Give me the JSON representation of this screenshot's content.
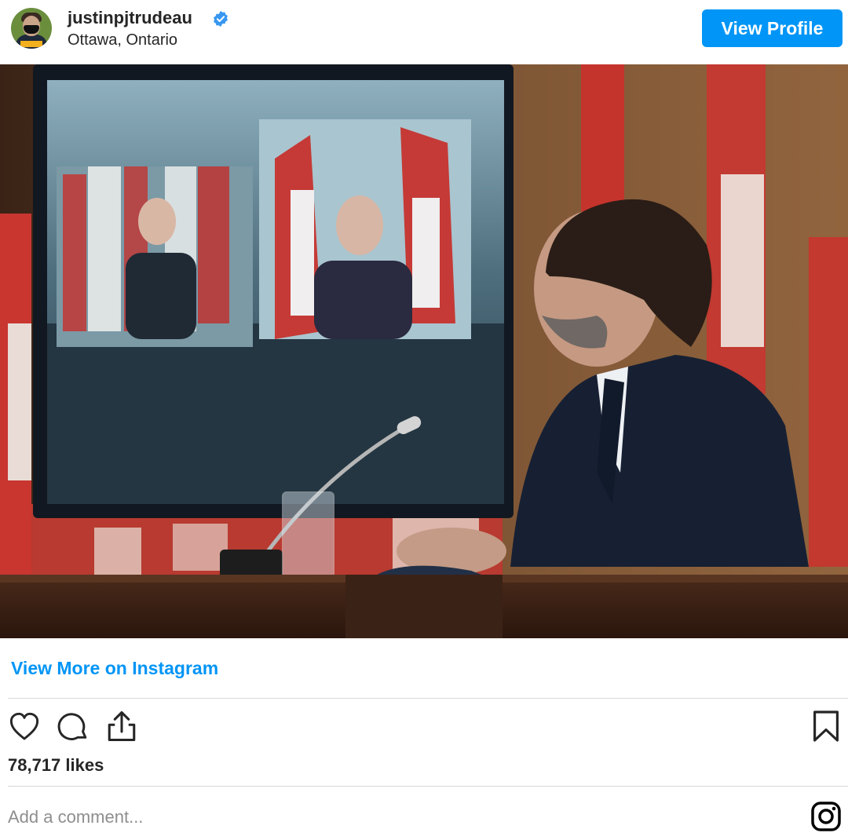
{
  "header": {
    "username": "justinpjtrudeau",
    "location": "Ottawa, Ontario",
    "view_profile_label": "View Profile"
  },
  "post": {
    "view_more_label": "View More on Instagram",
    "likes": "78,717 likes",
    "comment_placeholder": "Add a comment..."
  },
  "colors": {
    "accent": "#0095f6",
    "text": "#262626",
    "muted": "#8e8e8e"
  },
  "icons": [
    "verified-badge-icon",
    "heart-icon",
    "comment-icon",
    "share-icon",
    "bookmark-icon",
    "instagram-logo-icon"
  ]
}
